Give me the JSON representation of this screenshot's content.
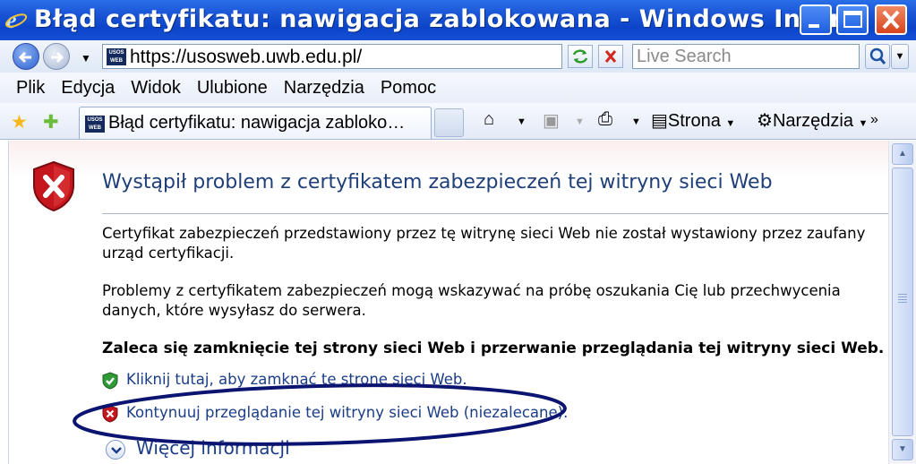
{
  "window": {
    "title": "Błąd certyfikatu: nawigacja zablokowana - Windows Inter…"
  },
  "address_bar": {
    "url": "https://usosweb.uwb.edu.pl/",
    "favicon_text_top": "USOS",
    "favicon_text_bottom": "WEB",
    "search_placeholder": "Live Search"
  },
  "menu": {
    "items": [
      "Plik",
      "Edycja",
      "Widok",
      "Ulubione",
      "Narzędzia",
      "Pomoc"
    ]
  },
  "tab": {
    "title": "Błąd certyfikatu: nawigacja zabloko…"
  },
  "command_bar": {
    "page_label": "Strona",
    "tools_label": "Narzędzia"
  },
  "content": {
    "heading": "Wystąpił problem z certyfikatem zabezpieczeń tej witryny sieci Web",
    "paragraph1": "Certyfikat zabezpieczeń przedstawiony przez tę witrynę sieci Web nie został wystawiony przez zaufany urząd certyfikacji.",
    "paragraph2": "Problemy z certyfikatem zabezpieczeń mogą wskazywać na próbę oszukania Cię lub przechwycenia danych, które wysyłasz do serwera.",
    "recommendation": "Zaleca się zamknięcie tej strony sieci Web i przerwanie przeglądania tej witryny sieci Web.",
    "close_link": "Kliknij tutaj, aby zamknąć tę stronę sieci Web.",
    "continue_link": "Kontynuuj przeglądanie tej witryny sieci Web (niezalecane).",
    "more_info": "Więcej informacji"
  },
  "colors": {
    "title_bar": "#1a55d6",
    "heading": "#1f3f78",
    "link": "#1b3d87",
    "annotation_ellipse": "#0b1470"
  }
}
